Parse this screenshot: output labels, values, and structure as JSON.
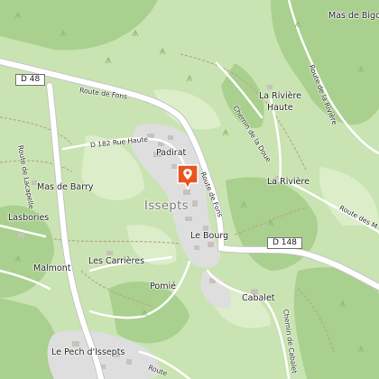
{
  "map": {
    "colors": {
      "land": "#c9e3b2",
      "forest": "#a9d08e",
      "field": "#dcedc9",
      "village": "#dedede",
      "building": "#c8c2ba",
      "road_main": "#ffffff",
      "road_casing": "#c6c6c6",
      "track": "#b8a88a",
      "pin": "#e9541f"
    },
    "roads": {
      "d48": "D 48",
      "d148": "D 148",
      "route_de_fons_north": "Route de Fons",
      "route_de_fons_east": "Route de Fons",
      "d182": "D 182 Rue Haute",
      "route_de_lacapelle": "Route de Lacapelle",
      "chemin_de_la_doue": "Chemin de la Doue",
      "route_de_la_riviere": "Route de la Rivière",
      "route_des_m": "Route des M",
      "chemin_de_cabalet": "Chemin de Cabalet",
      "route_bottom": "Route"
    },
    "places": {
      "mas_de_bigo": "Mas de Bigo",
      "la_riviere_haute_1": "La Rivière",
      "la_riviere_haute_2": "Haute",
      "la_riviere": "La Rivière",
      "padirat": "Padirat",
      "issepts": "Issepts",
      "le_bourg": "Le Bourg",
      "mas_de_barry": "Mas de Barry",
      "lasbories": "Lasbories",
      "les_carrieres": "Les Carrières",
      "malmont": "Malmont",
      "pomie": "Pomié",
      "cabalet": "Cabalet",
      "le_pech": "Le Pech d'Issepts"
    },
    "pin_icon": "map-pin-icon"
  }
}
